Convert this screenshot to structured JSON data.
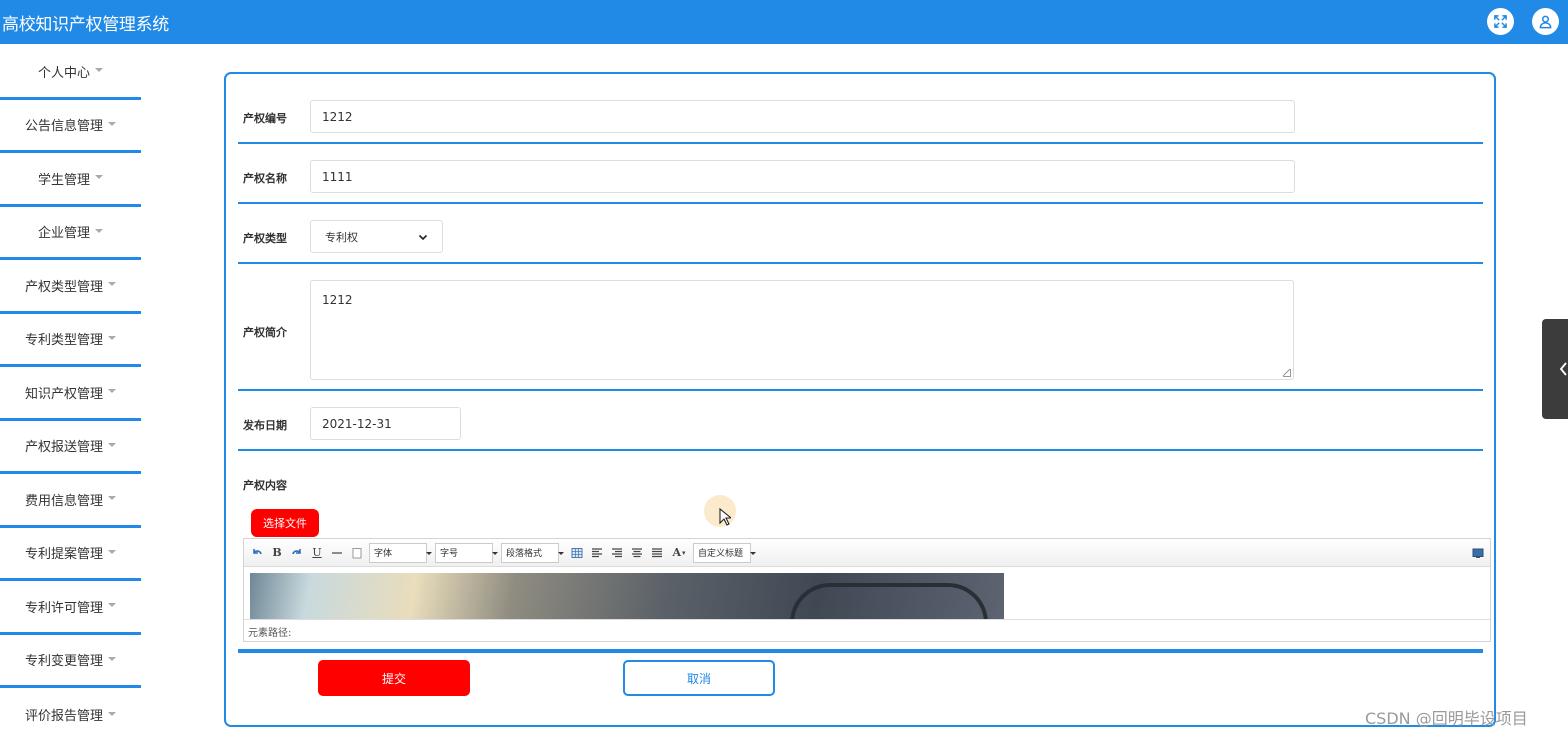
{
  "app": {
    "title": "高校知识产权管理系统"
  },
  "header": {
    "fullscreen_icon": "fullscreen-icon",
    "user_icon": "user-icon"
  },
  "sidebar": {
    "items": [
      {
        "label": "个人中心"
      },
      {
        "label": "公告信息管理"
      },
      {
        "label": "学生管理"
      },
      {
        "label": "企业管理"
      },
      {
        "label": "产权类型管理"
      },
      {
        "label": "专利类型管理"
      },
      {
        "label": "知识产权管理"
      },
      {
        "label": "产权报送管理"
      },
      {
        "label": "费用信息管理"
      },
      {
        "label": "专利提案管理"
      },
      {
        "label": "专利许可管理"
      },
      {
        "label": "专利变更管理"
      },
      {
        "label": "评价报告管理"
      }
    ]
  },
  "form": {
    "number": {
      "label": "产权编号",
      "value": "1212"
    },
    "name": {
      "label": "产权名称",
      "value": "1111"
    },
    "type": {
      "label": "产权类型",
      "value": "专利权"
    },
    "intro": {
      "label": "产权简介",
      "value": "1212"
    },
    "date": {
      "label": "发布日期",
      "value": "2021-12-31"
    },
    "content": {
      "label": "产权内容",
      "file_button": "选择文件"
    }
  },
  "editor": {
    "font_combo": "字体",
    "size_combo": "字号",
    "paragraph_combo": "段落格式",
    "heading_combo": "自定义标题",
    "element_path": "元素路径:"
  },
  "actions": {
    "submit": "提交",
    "cancel": "取消"
  },
  "watermark": "CSDN @回明毕设项目",
  "colors": {
    "primary": "#2189e6",
    "danger": "#ff0000"
  }
}
